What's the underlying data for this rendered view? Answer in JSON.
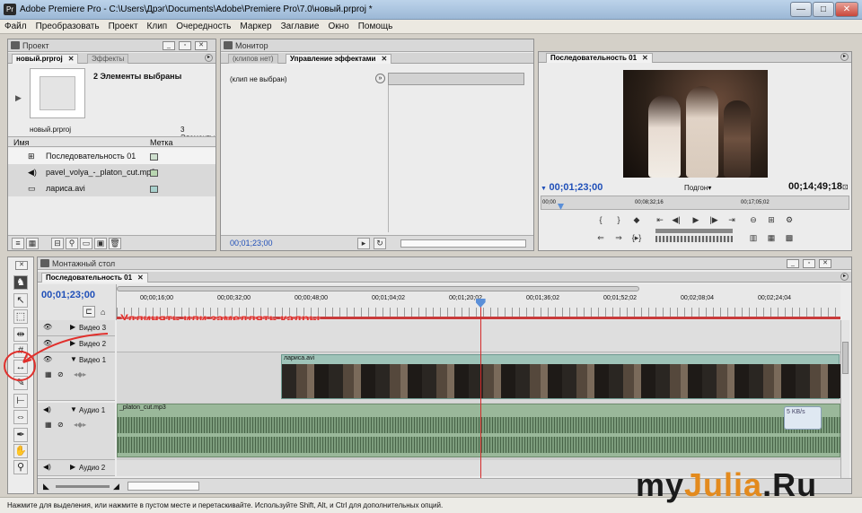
{
  "window": {
    "title": "Adobe Premiere Pro - C:\\Users\\Дрэг\\Documents\\Adobe\\Premiere Pro\\7.0\\новый.prproj *",
    "min": "—",
    "max": "□",
    "close": "✕"
  },
  "menu": [
    "Файл",
    "Преобразовать",
    "Проект",
    "Клип",
    "Очередность",
    "Маркер",
    "Заглавие",
    "Окно",
    "Помощь"
  ],
  "project": {
    "title": "Проект",
    "tabs": [
      {
        "label": "новый.prproj"
      },
      {
        "label": "Эффекты"
      }
    ],
    "selected_info": "2 Элементы выбраны",
    "file": "новый.prproj",
    "count": "3 Элементы",
    "col_name": "Имя",
    "col_label": "Метка",
    "items": [
      {
        "name": "Последовательность 01",
        "icon": "sequence-icon"
      },
      {
        "name": "pavel_volya_-_platon_cut.mp3",
        "icon": "audio-icon"
      },
      {
        "name": "лариса.avi",
        "icon": "video-icon"
      }
    ]
  },
  "monitor": {
    "title": "Монитор",
    "tabs": [
      {
        "label": "(клипов нет)"
      },
      {
        "label": "Управление эффектами"
      }
    ],
    "no_clip": "(клип не выбран)",
    "timecode": "00;01;23;00"
  },
  "program": {
    "tab": "Последовательность 01",
    "timecode_left": "00;01;23;00",
    "timecode_right": "00;14;49;18",
    "fit": "Подгон",
    "ruler": [
      "00;00",
      "00;08;32;16",
      "00;17;05;02"
    ]
  },
  "timeline": {
    "title": "Монтажный стол",
    "tab": "Последовательность 01",
    "timecode": "00;01;23;00",
    "ruler": [
      "00;00;16;00",
      "00;00;32;00",
      "00;00;48;00",
      "00;01;04;02",
      "00;01;20;02",
      "00;01;36;02",
      "00;01;52;02",
      "00;02;08;04",
      "00;02;24;04"
    ],
    "annotation": "Удлинять или замедлять кадры",
    "tracks": {
      "video3": "Видео 3",
      "video2": "Видео 2",
      "video1": "Видео 1",
      "audio1": "Аудио 1",
      "audio2": "Аудио 2"
    },
    "clip_video": "лариса.avi",
    "clip_audio": "_platon_cut.mp3",
    "speed": "5 KB/s",
    "playhead_fraction": 0.502
  },
  "status": "Нажмите для выделения, или нажмите в пустом месте и перетаскивайте. Используйте Shift, Alt, и Ctrl для дополнительных опций.",
  "watermark": "myJulia.Ru",
  "colors": {
    "timecode": "#1f4fb8",
    "playhead": "#d42a2a",
    "annotation": "#e0302c",
    "clip_video": "#9ec3b8",
    "clip_audio": "#9ab89a"
  }
}
